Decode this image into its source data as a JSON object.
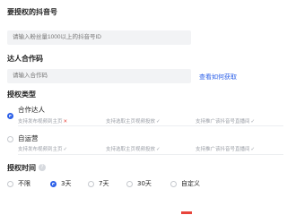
{
  "account": {
    "label": "要授权的抖音号",
    "placeholder": "请输入粉丝量1000以上的抖音号ID"
  },
  "code": {
    "label": "达人合作码",
    "placeholder": "请输入合作码",
    "help_link": "查看如何获取"
  },
  "auth_type": {
    "label": "授权类型",
    "options": [
      {
        "title": "合作达人",
        "selected": true,
        "features": [
          {
            "text": "支持发布视频到主页",
            "mark": "✕",
            "ok": false
          },
          {
            "text": "支持选取主页视频投放",
            "mark": "✓",
            "ok": true
          },
          {
            "text": "支持推广该抖音号直播间",
            "mark": "✓",
            "ok": true
          }
        ]
      },
      {
        "title": "自运营",
        "selected": false,
        "features": [
          {
            "text": "支持发布视频到主页",
            "mark": "✓",
            "ok": true
          },
          {
            "text": "支持选取主页视频投放",
            "mark": "✓",
            "ok": true
          },
          {
            "text": "支持推广该抖音号直播间",
            "mark": "✓",
            "ok": true
          }
        ]
      }
    ]
  },
  "auth_time": {
    "label": "授权时间",
    "help_icon": "question-icon",
    "options": [
      "不限",
      "3天",
      "7天",
      "30天",
      "自定义"
    ],
    "selected": "3天"
  },
  "colors": {
    "accent": "#2b5fe8",
    "danger": "#e8443a",
    "input_bg": "#f2f3f5"
  }
}
